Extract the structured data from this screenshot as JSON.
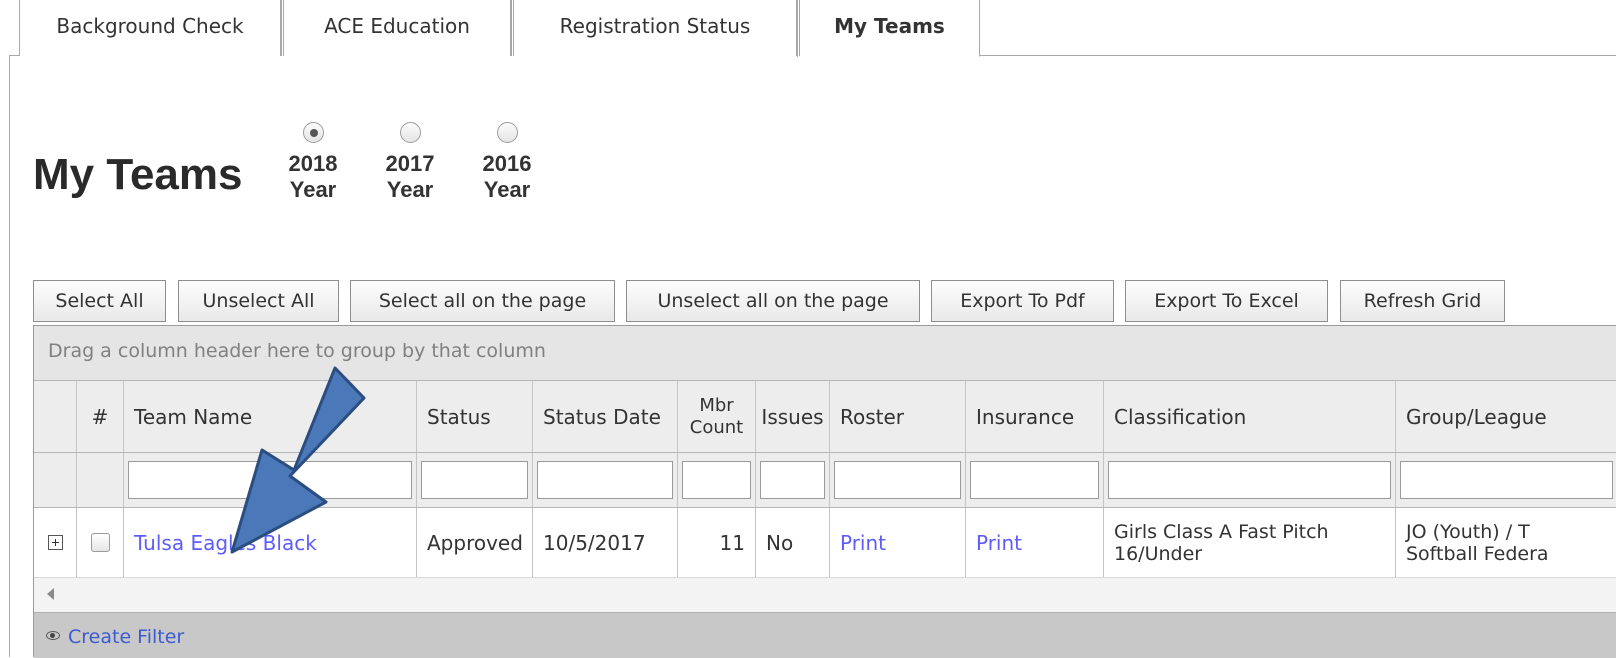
{
  "tabs": [
    {
      "label": "Background Check"
    },
    {
      "label": "ACE Education"
    },
    {
      "label": "Registration Status"
    },
    {
      "label": "My Teams"
    }
  ],
  "page_title": "My Teams",
  "years": [
    {
      "value": "2018",
      "unit": "Year",
      "selected": true
    },
    {
      "value": "2017",
      "unit": "Year",
      "selected": false
    },
    {
      "value": "2016",
      "unit": "Year",
      "selected": false
    }
  ],
  "toolbar": {
    "select_all": "Select All",
    "unselect_all": "Unselect All",
    "select_page": "Select all on the page",
    "unselect_page": "Unselect all on the page",
    "export_pdf": "Export To Pdf",
    "export_excel": "Export To Excel",
    "refresh": "Refresh Grid"
  },
  "grid": {
    "group_hint": "Drag a column header here to group by that column",
    "columns": {
      "num": "#",
      "team_name": "Team Name",
      "status": "Status",
      "status_date": "Status Date",
      "mbr_count_line1": "Mbr",
      "mbr_count_line2": "Count",
      "issues": "Issues",
      "roster": "Roster",
      "insurance": "Insurance",
      "classification": "Classification",
      "group_league": "Group/League"
    },
    "rows": [
      {
        "team_name": "Tulsa Eagles Black",
        "status": "Approved",
        "status_date": "10/5/2017",
        "mbr_count": "11",
        "issues": "No",
        "roster": "Print",
        "insurance": "Print",
        "classification": "Girls Class A Fast Pitch 16/Under",
        "group_league_line1": "JO (Youth) / T",
        "group_league_line2": "Softball Federa"
      }
    ],
    "create_filter": "Create Filter"
  },
  "colors": {
    "link": "#5c5cff",
    "arrow": "#4a78b8",
    "arrow_outline": "#2c4d80"
  }
}
